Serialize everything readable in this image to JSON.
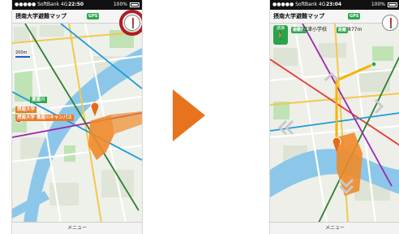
{
  "left_screen": {
    "status": {
      "carrier": "●●●●● SoftBank 4G",
      "time": "22:50",
      "battery": "100%"
    },
    "title": "摂南大学避難マップ",
    "gps_label": "GPS",
    "scale_label": "200m",
    "map_labels": {
      "campus": "摂南大学 寝屋川キャンパス",
      "campus_top": "摂南大学",
      "station": "寝屋川"
    },
    "menu_label": "メニュー"
  },
  "right_screen": {
    "status": {
      "carrier": "●●●●● SoftBank 4G",
      "time": "23:04",
      "battery": "100%"
    },
    "title": "摂南大学避難マップ",
    "gps_label": "GPS",
    "nav_button": "誘導",
    "school_tag": "避難所",
    "school_name": "石津小学校",
    "distance_tag": "距離",
    "distance": "877m",
    "menu_label": "メニュー"
  },
  "colors": {
    "accent_orange": "#e8731f",
    "highlight_ring": "#b01c26",
    "gps_green": "#2fa84f"
  }
}
